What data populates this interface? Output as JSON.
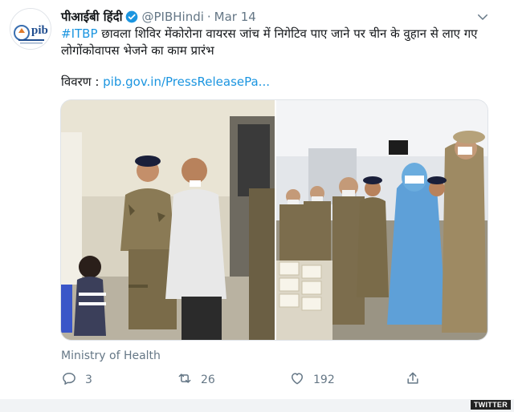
{
  "tweet": {
    "display_name": "पीआईबी हिंदी",
    "handle": "@PIBHindi",
    "separator": "·",
    "date": "Mar 14",
    "hashtag": "#ITBP",
    "text_rest": " छावला शिविर मेंकोरोना वायरस जांच में निगेटिव पाए जाने पर चीन के वुहान से लाए गए लोगोंकोवापस भेजने का काम प्रारंभ",
    "details_label": "विवरण : ",
    "details_link": "pib.gov.in/PressReleasePa...",
    "source": "Ministry of Health",
    "counts": {
      "replies": "3",
      "retweets": "26",
      "likes": "192"
    },
    "brand_color": "#1b95e0"
  },
  "avatar_logo_text": "pib",
  "watermark": "TWITTER",
  "icons": [
    "verified-icon",
    "chevron-down-icon",
    "reply-icon",
    "retweet-icon",
    "like-icon",
    "share-icon"
  ]
}
